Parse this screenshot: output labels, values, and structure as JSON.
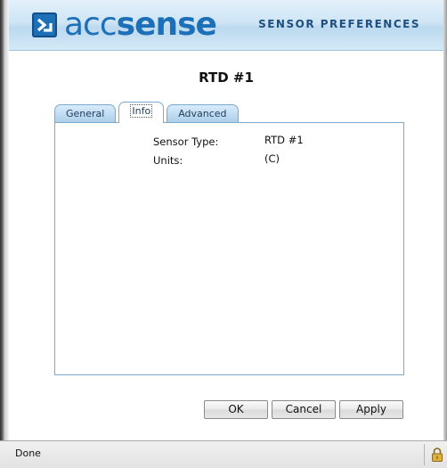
{
  "header": {
    "logo_left": "acc",
    "logo_right": "sense",
    "title": "SENSOR PREFERENCES",
    "logo_icon": "accsense-logo-icon"
  },
  "dialog": {
    "sensor_name": "RTD #1",
    "tabs": [
      {
        "label": "General",
        "active": false
      },
      {
        "label": "Info",
        "active": true
      },
      {
        "label": "Advanced",
        "active": false
      }
    ],
    "info": {
      "sensor_type_label": "Sensor Type:",
      "sensor_type_value": "RTD #1",
      "units_label": "Units:",
      "units_value": "(C)"
    },
    "buttons": {
      "ok": "OK",
      "cancel": "Cancel",
      "apply": "Apply"
    }
  },
  "statusbar": {
    "text": "Done",
    "icon": "lock-icon"
  },
  "colors": {
    "brand": "#1d6fb8",
    "header_bg": "#cfe5f5",
    "tab_bg": "#aacde9",
    "panel_border": "#7fa9cb"
  }
}
